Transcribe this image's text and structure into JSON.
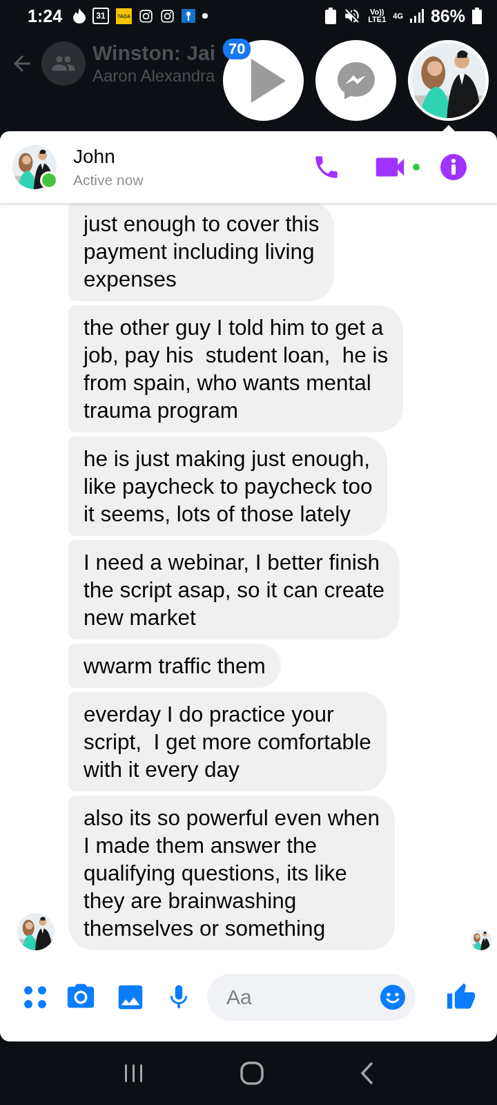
{
  "status_bar": {
    "time": "1:24",
    "calendar_day": "31",
    "tada": "TADA",
    "volte": "Vo))",
    "lte": "LTE1",
    "network": "4G",
    "battery": "86%"
  },
  "background_conversation": {
    "title": "Winston: Jai",
    "subtitle": "Aaron Alexandra"
  },
  "chat_heads": [
    {
      "kind": "video",
      "badge": "70"
    },
    {
      "kind": "messenger"
    },
    {
      "kind": "contact"
    }
  ],
  "conversation": {
    "name": "John",
    "status": "Active now",
    "online": true,
    "video_online": true
  },
  "messages": [
    {
      "text": "just enough to cover this\npayment including living\nexpenses"
    },
    {
      "text": "the other guy I told him to get a\njob, pay his  student loan,  he is\nfrom spain, who wants mental\ntrauma program"
    },
    {
      "text": "he is just making just enough,\nlike paycheck to paycheck too\nit seems, lots of those lately"
    },
    {
      "text": "I need a webinar, I better finish\nthe script asap, so it can create\nnew market"
    },
    {
      "text": "wwarm traffic them"
    },
    {
      "text": "everday I do practice your\nscript,  I get more comfortable\nwith it every day"
    },
    {
      "text": "also its so powerful even when\nI made them answer the\nqualifying questions, its like\nthey are brainwashing\nthemselves or something"
    }
  ],
  "composer": {
    "placeholder": "Aa"
  }
}
